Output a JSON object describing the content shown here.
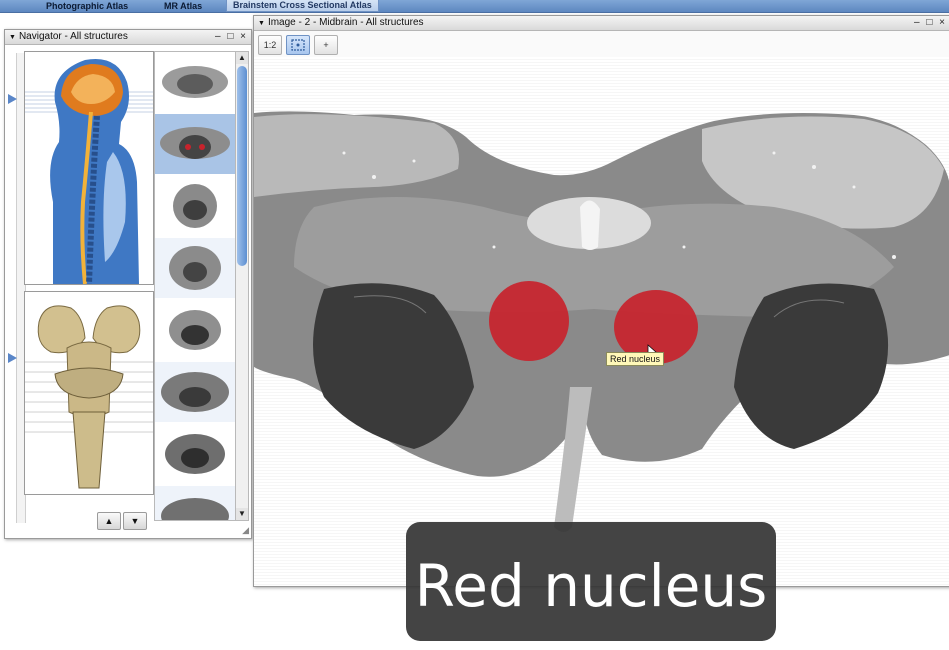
{
  "topbar": {
    "tabs": [
      {
        "label": "Photographic Atlas"
      },
      {
        "label": "MR Atlas"
      },
      {
        "label": "Brainstem Cross Sectional Atlas"
      }
    ]
  },
  "navigator": {
    "title": "Navigator - All structures",
    "window_controls": "– □ ×",
    "up_label": "▲",
    "down_label": "▼"
  },
  "image_window": {
    "title": "Image - 2 - Midbrain - All structures",
    "window_controls": "– □ ×",
    "toolbar": [
      {
        "icon": "scale-ruler-icon",
        "label": "1:2"
      },
      {
        "icon": "fit-to-window-icon",
        "label": "",
        "active": true
      },
      {
        "icon": "crosshair-icon",
        "label": "+"
      }
    ],
    "tooltip": "Red nucleus"
  },
  "caption": "Red nucleus",
  "colors": {
    "highlight_red": "#c8232c",
    "tab_bar": "#6a93cc",
    "selection": "#a9c4e6"
  }
}
